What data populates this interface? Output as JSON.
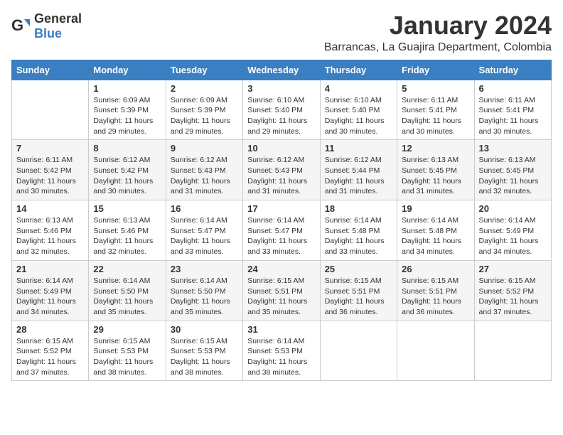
{
  "logo": {
    "general": "General",
    "blue": "Blue"
  },
  "title": "January 2024",
  "subtitle": "Barrancas, La Guajira Department, Colombia",
  "days_header": [
    "Sunday",
    "Monday",
    "Tuesday",
    "Wednesday",
    "Thursday",
    "Friday",
    "Saturday"
  ],
  "weeks": [
    [
      {
        "day": "",
        "info": ""
      },
      {
        "day": "1",
        "info": "Sunrise: 6:09 AM\nSunset: 5:39 PM\nDaylight: 11 hours\nand 29 minutes."
      },
      {
        "day": "2",
        "info": "Sunrise: 6:09 AM\nSunset: 5:39 PM\nDaylight: 11 hours\nand 29 minutes."
      },
      {
        "day": "3",
        "info": "Sunrise: 6:10 AM\nSunset: 5:40 PM\nDaylight: 11 hours\nand 29 minutes."
      },
      {
        "day": "4",
        "info": "Sunrise: 6:10 AM\nSunset: 5:40 PM\nDaylight: 11 hours\nand 30 minutes."
      },
      {
        "day": "5",
        "info": "Sunrise: 6:11 AM\nSunset: 5:41 PM\nDaylight: 11 hours\nand 30 minutes."
      },
      {
        "day": "6",
        "info": "Sunrise: 6:11 AM\nSunset: 5:41 PM\nDaylight: 11 hours\nand 30 minutes."
      }
    ],
    [
      {
        "day": "7",
        "info": "Sunrise: 6:11 AM\nSunset: 5:42 PM\nDaylight: 11 hours\nand 30 minutes."
      },
      {
        "day": "8",
        "info": "Sunrise: 6:12 AM\nSunset: 5:42 PM\nDaylight: 11 hours\nand 30 minutes."
      },
      {
        "day": "9",
        "info": "Sunrise: 6:12 AM\nSunset: 5:43 PM\nDaylight: 11 hours\nand 31 minutes."
      },
      {
        "day": "10",
        "info": "Sunrise: 6:12 AM\nSunset: 5:43 PM\nDaylight: 11 hours\nand 31 minutes."
      },
      {
        "day": "11",
        "info": "Sunrise: 6:12 AM\nSunset: 5:44 PM\nDaylight: 11 hours\nand 31 minutes."
      },
      {
        "day": "12",
        "info": "Sunrise: 6:13 AM\nSunset: 5:45 PM\nDaylight: 11 hours\nand 31 minutes."
      },
      {
        "day": "13",
        "info": "Sunrise: 6:13 AM\nSunset: 5:45 PM\nDaylight: 11 hours\nand 32 minutes."
      }
    ],
    [
      {
        "day": "14",
        "info": "Sunrise: 6:13 AM\nSunset: 5:46 PM\nDaylight: 11 hours\nand 32 minutes."
      },
      {
        "day": "15",
        "info": "Sunrise: 6:13 AM\nSunset: 5:46 PM\nDaylight: 11 hours\nand 32 minutes."
      },
      {
        "day": "16",
        "info": "Sunrise: 6:14 AM\nSunset: 5:47 PM\nDaylight: 11 hours\nand 33 minutes."
      },
      {
        "day": "17",
        "info": "Sunrise: 6:14 AM\nSunset: 5:47 PM\nDaylight: 11 hours\nand 33 minutes."
      },
      {
        "day": "18",
        "info": "Sunrise: 6:14 AM\nSunset: 5:48 PM\nDaylight: 11 hours\nand 33 minutes."
      },
      {
        "day": "19",
        "info": "Sunrise: 6:14 AM\nSunset: 5:48 PM\nDaylight: 11 hours\nand 34 minutes."
      },
      {
        "day": "20",
        "info": "Sunrise: 6:14 AM\nSunset: 5:49 PM\nDaylight: 11 hours\nand 34 minutes."
      }
    ],
    [
      {
        "day": "21",
        "info": "Sunrise: 6:14 AM\nSunset: 5:49 PM\nDaylight: 11 hours\nand 34 minutes."
      },
      {
        "day": "22",
        "info": "Sunrise: 6:14 AM\nSunset: 5:50 PM\nDaylight: 11 hours\nand 35 minutes."
      },
      {
        "day": "23",
        "info": "Sunrise: 6:14 AM\nSunset: 5:50 PM\nDaylight: 11 hours\nand 35 minutes."
      },
      {
        "day": "24",
        "info": "Sunrise: 6:15 AM\nSunset: 5:51 PM\nDaylight: 11 hours\nand 35 minutes."
      },
      {
        "day": "25",
        "info": "Sunrise: 6:15 AM\nSunset: 5:51 PM\nDaylight: 11 hours\nand 36 minutes."
      },
      {
        "day": "26",
        "info": "Sunrise: 6:15 AM\nSunset: 5:51 PM\nDaylight: 11 hours\nand 36 minutes."
      },
      {
        "day": "27",
        "info": "Sunrise: 6:15 AM\nSunset: 5:52 PM\nDaylight: 11 hours\nand 37 minutes."
      }
    ],
    [
      {
        "day": "28",
        "info": "Sunrise: 6:15 AM\nSunset: 5:52 PM\nDaylight: 11 hours\nand 37 minutes."
      },
      {
        "day": "29",
        "info": "Sunrise: 6:15 AM\nSunset: 5:53 PM\nDaylight: 11 hours\nand 38 minutes."
      },
      {
        "day": "30",
        "info": "Sunrise: 6:15 AM\nSunset: 5:53 PM\nDaylight: 11 hours\nand 38 minutes."
      },
      {
        "day": "31",
        "info": "Sunrise: 6:14 AM\nSunset: 5:53 PM\nDaylight: 11 hours\nand 38 minutes."
      },
      {
        "day": "",
        "info": ""
      },
      {
        "day": "",
        "info": ""
      },
      {
        "day": "",
        "info": ""
      }
    ]
  ]
}
